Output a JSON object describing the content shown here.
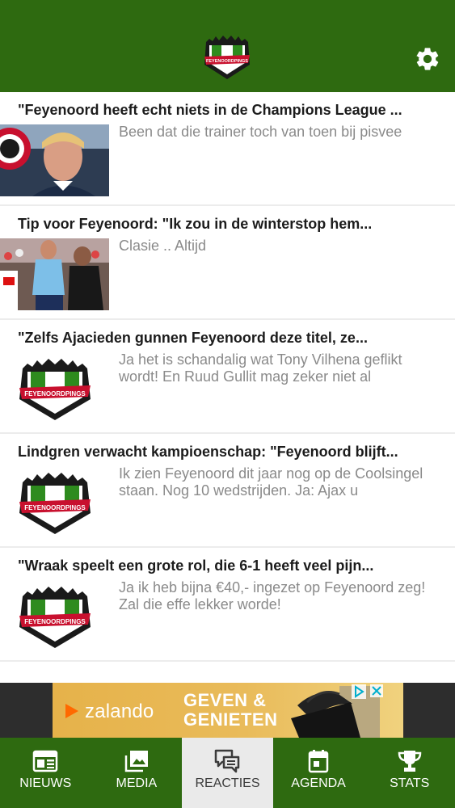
{
  "header": {
    "logo_text": "FEYENOORDPINGS"
  },
  "feed": {
    "items": [
      {
        "title": "\"Feyenoord heeft echt niets in de Champions League ...",
        "text": "Been dat die trainer toch van toen bij pisvee",
        "thumb": "photo-trainer"
      },
      {
        "title": "Tip voor Feyenoord: \"Ik zou in de winterstop hem...",
        "text": "Clasie .. Altijd",
        "thumb": "photo-players"
      },
      {
        "title": "\"Zelfs Ajacieden gunnen Feyenoord deze titel, ze...",
        "text": "Ja het is schandalig wat Tony Vilhena geflikt wordt! En Ruud Gullit mag zeker niet al",
        "thumb": "logo"
      },
      {
        "title": "Lindgren verwacht kampioenschap: \"Feyenoord blijft...",
        "text": "Ik zien Feyenoord dit jaar nog op de Coolsingel staan. Nog 10 wedstrijden. Ja: Ajax u",
        "thumb": "logo"
      },
      {
        "title": "\"Wraak speelt een grote rol, die 6-1 heeft veel pijn...",
        "text": "Ja ik heb bijna €40,- ingezet op Feyenoord zeg! Zal die effe lekker worde!",
        "thumb": "logo"
      }
    ]
  },
  "ad": {
    "brand": "zalando",
    "headline_line1": "GEVEN &",
    "headline_line2": "GENIETEN"
  },
  "nav": {
    "tabs": [
      {
        "label": "NIEUWS",
        "icon": "newspaper-icon",
        "active": false
      },
      {
        "label": "MEDIA",
        "icon": "image-icon",
        "active": false
      },
      {
        "label": "REACTIES",
        "icon": "chat-icon",
        "active": true
      },
      {
        "label": "AGENDA",
        "icon": "calendar-icon",
        "active": false
      },
      {
        "label": "STATS",
        "icon": "trophy-icon",
        "active": false
      }
    ]
  },
  "colors": {
    "brand_green": "#2e6a10",
    "active_tab_bg": "#eaeaea",
    "comment_gray": "#8a8a8a"
  }
}
